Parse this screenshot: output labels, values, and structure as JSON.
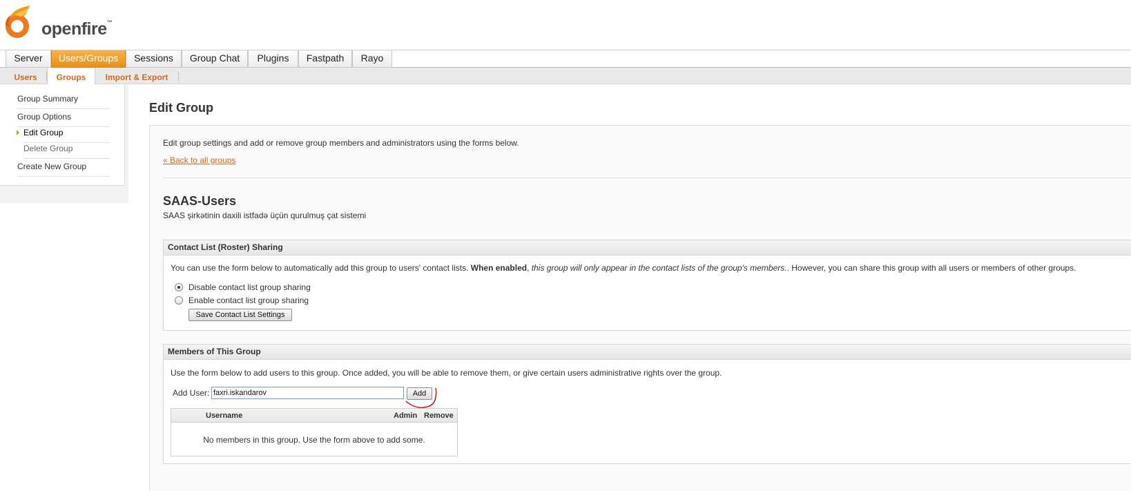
{
  "brand": {
    "name": "openfire",
    "tm": "™"
  },
  "main_tabs": [
    "Server",
    "Users/Groups",
    "Sessions",
    "Group Chat",
    "Plugins",
    "Fastpath",
    "Rayo"
  ],
  "active_main_tab": "Users/Groups",
  "sub_tabs": [
    "Users",
    "Groups",
    "Import & Export"
  ],
  "active_sub_tab": "Groups",
  "sidebar": {
    "items": [
      {
        "label": "Group Summary"
      },
      {
        "label": "Group Options"
      },
      {
        "label": "Edit Group",
        "current": true
      },
      {
        "label": "Delete Group"
      },
      {
        "label": "Create New Group"
      }
    ]
  },
  "page": {
    "title": "Edit Group",
    "intro": "Edit group settings and add or remove group members and administrators using the forms below.",
    "back_link": "« Back to all groups",
    "group_name": "SAAS-Users",
    "group_description": "SAAS şirkətinin daxili istfadə üçün qurulmuş çat sistemi"
  },
  "sharing": {
    "heading": "Contact List (Roster) Sharing",
    "text_before": "You can use the form below to automatically add this group to users' contact lists. ",
    "text_bold": "When enabled",
    "text_comma": ", ",
    "text_italic": "this group will only appear in the contact lists of the group's members.",
    "text_after": ". However, you can share this group with all users or members of other groups.",
    "option_disable": "Disable contact list group sharing",
    "option_enable": "Enable contact list group sharing",
    "selected": "disable",
    "save_button": "Save Contact List Settings"
  },
  "members": {
    "heading": "Members of This Group",
    "text": "Use the form below to add users to this group. Once added, you will be able to remove them, or give certain users administrative rights over the group.",
    "add_label": "Add User:",
    "add_value": "faxri.iskandarov",
    "add_button": "Add",
    "col_username": "Username",
    "col_admin": "Admin",
    "col_remove": "Remove",
    "empty": "No members in this group. Use the form above to add some."
  },
  "colors": {
    "accent": "#e8901a",
    "link": "#d2691e",
    "annotation": "#d40000"
  }
}
